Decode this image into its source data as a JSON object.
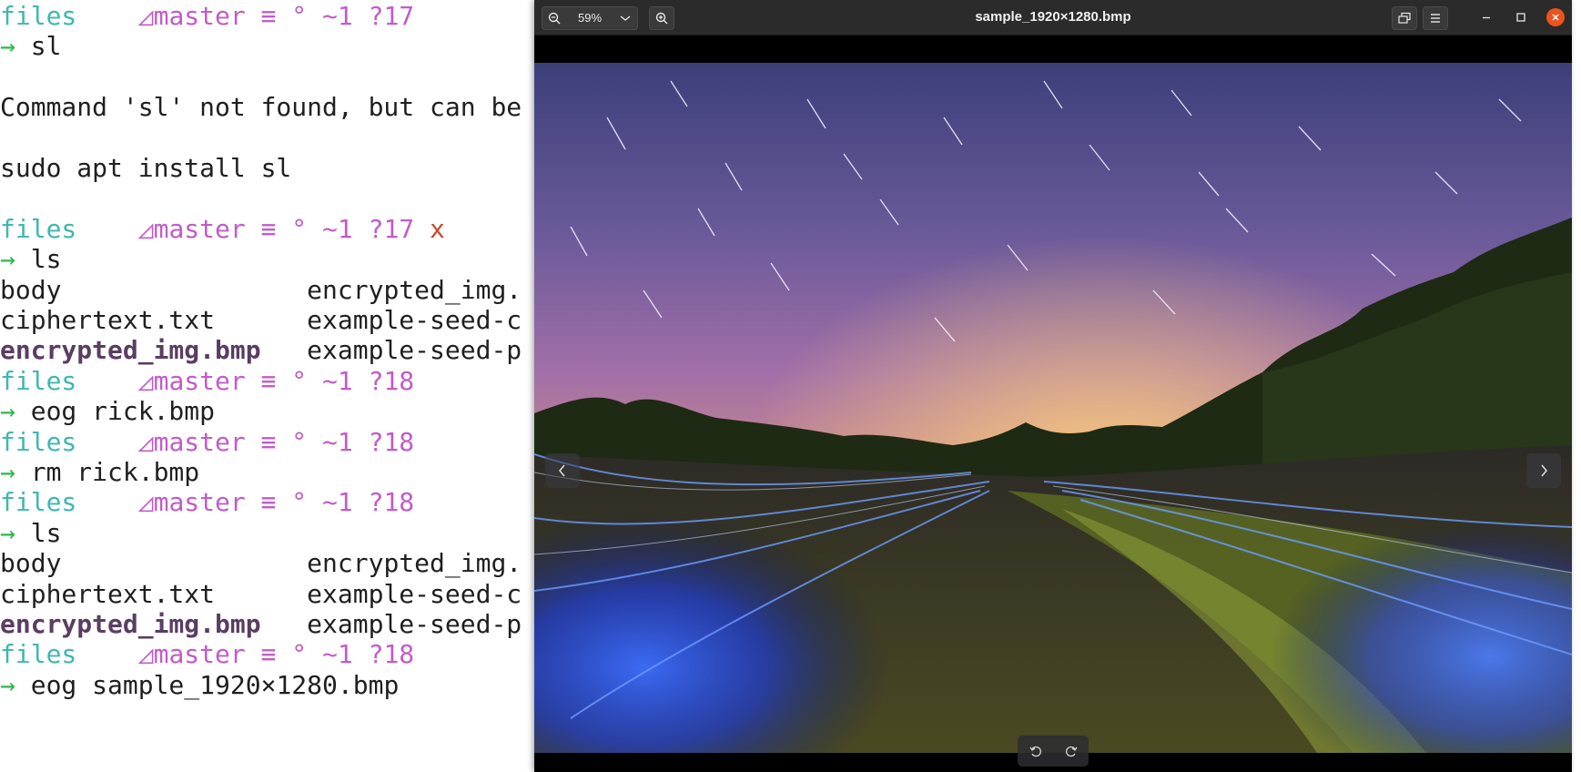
{
  "terminal": {
    "lines": [
      [
        {
          "t": "files",
          "c": "dir"
        },
        {
          "t": "    ◿master ≡ ° ~1 ?17",
          "c": "branch"
        }
      ],
      [
        {
          "t": "→ ",
          "c": "arrow"
        },
        {
          "t": "sl",
          "c": "plain"
        }
      ],
      [],
      [
        {
          "t": "Command 'sl' not found, but can be installed with:",
          "c": "plain"
        }
      ],
      [],
      [
        {
          "t": "sudo apt install sl",
          "c": "plain"
        }
      ],
      [],
      [
        {
          "t": "files",
          "c": "dir"
        },
        {
          "t": "    ◿master ≡ ° ~1 ?17 ",
          "c": "branch"
        },
        {
          "t": "x",
          "c": "x"
        }
      ],
      [
        {
          "t": "→ ",
          "c": "arrow"
        },
        {
          "t": "ls",
          "c": "plain"
        }
      ],
      [
        {
          "t": "body                ",
          "c": "plain"
        },
        {
          "t": "encrypted_img.",
          "c": "plain"
        }
      ],
      [
        {
          "t": "ciphertext.txt      ",
          "c": "plain"
        },
        {
          "t": "example-seed-c",
          "c": "plain"
        }
      ],
      [
        {
          "t": "encrypted_img.bmp",
          "c": "bold"
        },
        {
          "t": "   example-seed-p",
          "c": "plain"
        }
      ],
      [
        {
          "t": "files",
          "c": "dir"
        },
        {
          "t": "    ◿master ≡ ° ~1 ?18",
          "c": "branch"
        }
      ],
      [
        {
          "t": "→ ",
          "c": "arrow"
        },
        {
          "t": "eog rick.bmp",
          "c": "plain"
        }
      ],
      [
        {
          "t": "files",
          "c": "dir"
        },
        {
          "t": "    ◿master ≡ ° ~1 ?18",
          "c": "branch"
        }
      ],
      [
        {
          "t": "→ ",
          "c": "arrow"
        },
        {
          "t": "rm rick.bmp",
          "c": "plain"
        }
      ],
      [
        {
          "t": "files",
          "c": "dir"
        },
        {
          "t": "    ◿master ≡ ° ~1 ?18",
          "c": "branch"
        }
      ],
      [
        {
          "t": "→ ",
          "c": "arrow"
        },
        {
          "t": "ls",
          "c": "plain"
        }
      ],
      [
        {
          "t": "body                ",
          "c": "plain"
        },
        {
          "t": "encrypted_img.",
          "c": "plain"
        }
      ],
      [
        {
          "t": "ciphertext.txt      ",
          "c": "plain"
        },
        {
          "t": "example-seed-c",
          "c": "plain"
        }
      ],
      [
        {
          "t": "encrypted_img.bmp",
          "c": "bold"
        },
        {
          "t": "   example-seed-p",
          "c": "plain"
        }
      ],
      [
        {
          "t": "files",
          "c": "dir"
        },
        {
          "t": "    ◿master ≡ ° ~1 ?18",
          "c": "branch"
        }
      ],
      [
        {
          "t": "→ ",
          "c": "arrow"
        },
        {
          "t": "eog sample_1920×1280.bmp",
          "c": "plain"
        }
      ]
    ]
  },
  "viewer": {
    "title": "sample_1920×1280.bmp",
    "zoom_label": "59%",
    "icons": {
      "zoom_out": "zoom-out-icon",
      "zoom_dropdown": "chevron-down-icon",
      "zoom_in": "zoom-in-icon",
      "gallery": "gallery-icon",
      "menu": "hamburger-menu-icon",
      "minimize": "minimize-icon",
      "maximize": "maximize-icon",
      "close": "close-icon",
      "prev": "chevron-left-icon",
      "next": "chevron-right-icon",
      "rotate_left": "rotate-left-icon",
      "rotate_right": "rotate-right-icon"
    },
    "colors": {
      "close": "#e95420",
      "titlebar": "#2b2b2b"
    }
  }
}
